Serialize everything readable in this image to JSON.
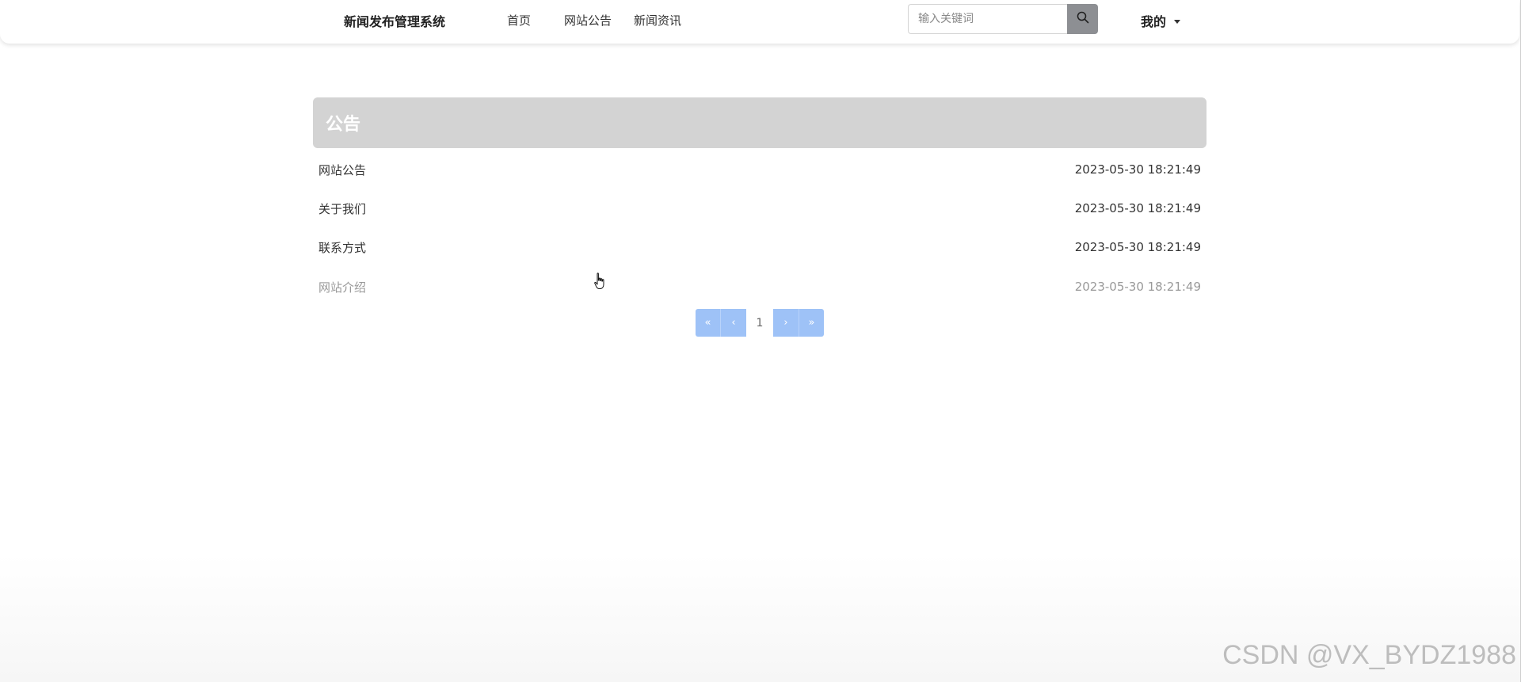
{
  "header": {
    "brand": "新闻发布管理系统",
    "nav": [
      {
        "label": "首页"
      },
      {
        "label": "网站公告"
      },
      {
        "label": "新闻资讯"
      }
    ],
    "search": {
      "placeholder": "输入关键词",
      "value": "",
      "icon": "search-icon"
    },
    "user_menu": {
      "label": "我的",
      "icon": "caret-down-icon"
    }
  },
  "notice": {
    "title": "公告",
    "items": [
      {
        "title": "网站公告",
        "time": "2023-05-30 18:21:49"
      },
      {
        "title": "关于我们",
        "time": "2023-05-30 18:21:49"
      },
      {
        "title": "联系方式",
        "time": "2023-05-30 18:21:49"
      },
      {
        "title": "网站介绍",
        "time": "2023-05-30 18:21:49"
      }
    ]
  },
  "pagination": {
    "first": "«",
    "prev": "‹",
    "current": "1",
    "next": "›",
    "last": "»"
  },
  "watermark": "CSDN @VX_BYDZ1988"
}
